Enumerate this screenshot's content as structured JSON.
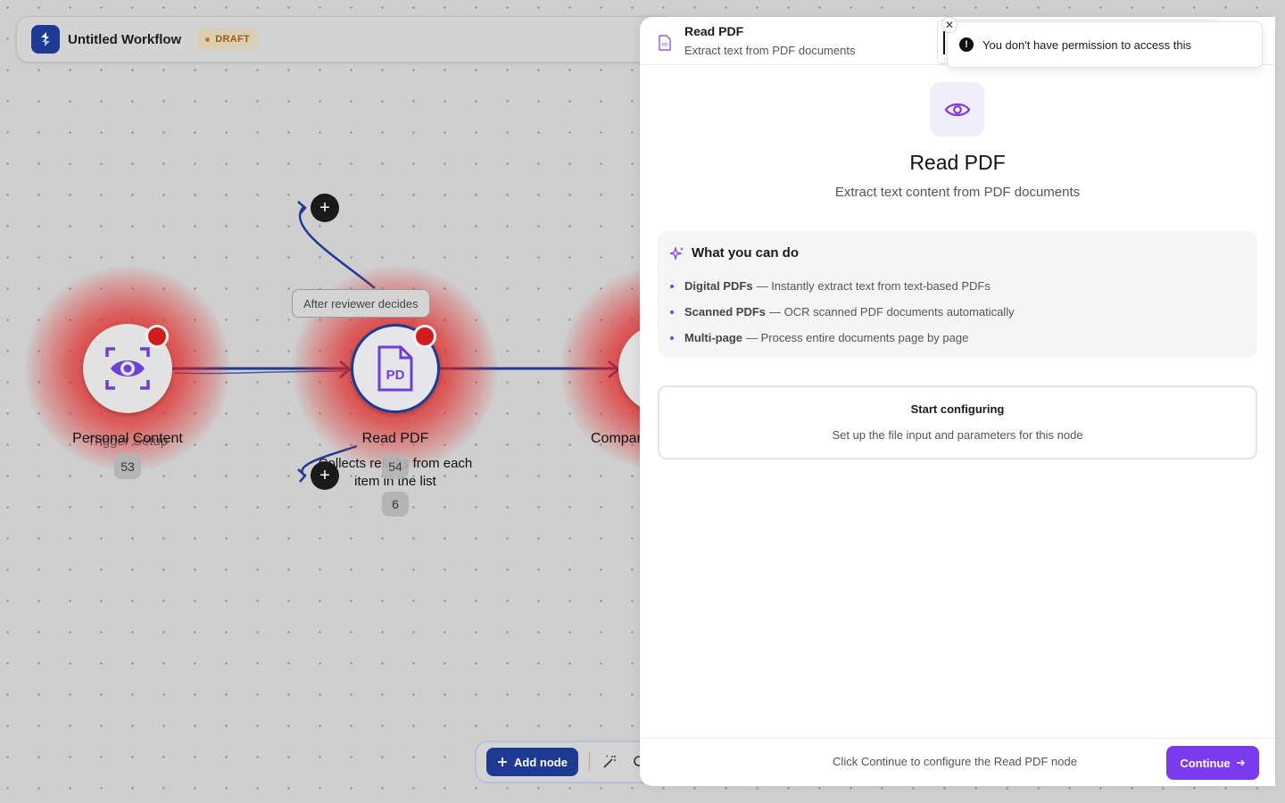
{
  "workflow": {
    "title": "Untitled Workflow",
    "status_badge": "DRAFT"
  },
  "canvas": {
    "edge_label": "After reviewer decides",
    "nodes": [
      {
        "label": "Personal Content",
        "sub": "Trigger Setup",
        "count": "53",
        "icon": "eye-scan-icon"
      },
      {
        "label": "Read PDF",
        "sub": "Collects results from each item in the list",
        "count": "54",
        "count2": "6",
        "icon": "pdf-file-icon"
      },
      {
        "label": "Compare",
        "icon": "node-icon"
      }
    ],
    "plus_icon": "+"
  },
  "toolbar": {
    "add_node_label": "Add node"
  },
  "panel": {
    "header_title": "Read PDF",
    "header_sub": "Extract text from PDF documents",
    "hero_title": "Read PDF",
    "hero_sub": "Extract text content from PDF documents",
    "capabilities_title": "What you can do",
    "capabilities": [
      {
        "strong": "Digital PDFs",
        "rest": "— Instantly extract text from text-based PDFs"
      },
      {
        "strong": "Scanned PDFs",
        "rest": "— OCR scanned PDF documents automatically"
      },
      {
        "strong": "Multi-page",
        "rest": "— Process entire documents page by page"
      }
    ],
    "start_title": "Start configuring",
    "start_sub": "Set up the file input and parameters for this node",
    "footer_hint": "Click Continue to configure the Read PDF node",
    "continue_label": "Continue"
  },
  "toast": {
    "message": "You don't have permission to access this",
    "icon": "!",
    "close": "✕"
  },
  "colors": {
    "accent": "#7c3aed",
    "primary": "#1f3a93",
    "error_glow": "#e11e1e",
    "draft": "#9b5d12"
  }
}
